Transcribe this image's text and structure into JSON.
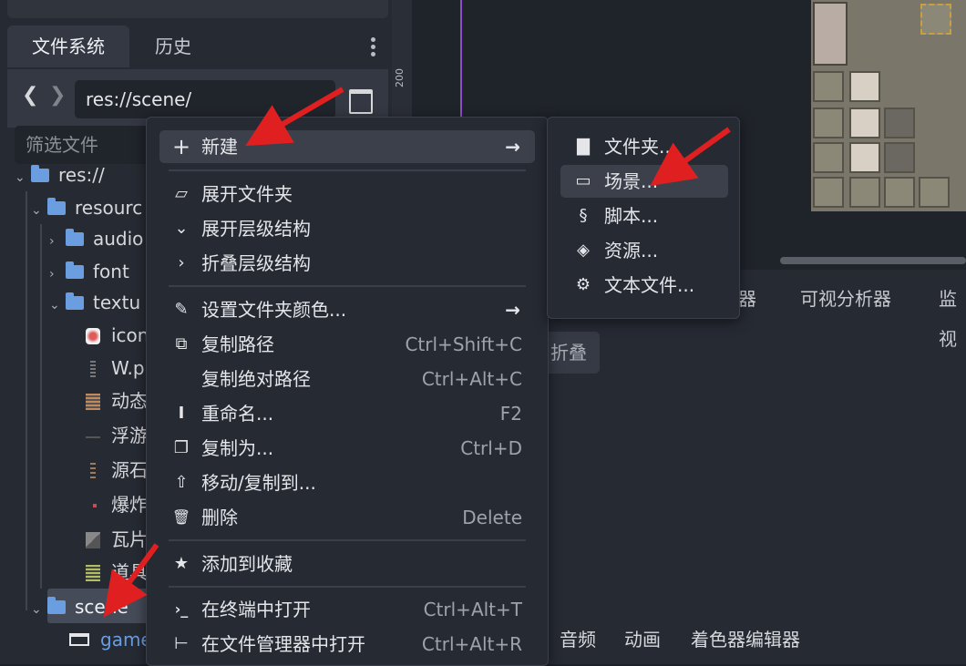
{
  "filesystem": {
    "tabs": [
      "文件系统",
      "历史"
    ],
    "path": "res://scene/",
    "filter_placeholder": "筛选文件",
    "ruler_label": "200",
    "tree": [
      {
        "label": "res://",
        "type": "folder"
      },
      {
        "label": "resourc",
        "type": "folder"
      },
      {
        "label": "audio",
        "type": "folder"
      },
      {
        "label": "font",
        "type": "folder"
      },
      {
        "label": "textu",
        "type": "folder"
      },
      {
        "label": "icon",
        "type": "file"
      },
      {
        "label": "W.p",
        "type": "file"
      },
      {
        "label": "动态",
        "type": "file"
      },
      {
        "label": "浮游",
        "type": "file"
      },
      {
        "label": "源石",
        "type": "file"
      },
      {
        "label": "爆炸",
        "type": "file"
      },
      {
        "label": "瓦片",
        "type": "file"
      },
      {
        "label": "道具",
        "type": "file"
      },
      {
        "label": "scene",
        "type": "folder"
      },
      {
        "label": "game",
        "type": "scene"
      }
    ]
  },
  "context_menu": {
    "items": [
      {
        "icon": "plus-icon",
        "glyph": "+",
        "label": "新建",
        "shortcut": "",
        "submenu": true
      },
      {
        "icon": "folder-open-icon",
        "glyph": "▱",
        "label": "展开文件夹",
        "shortcut": "",
        "submenu": false
      },
      {
        "icon": "chevron-down-icon",
        "glyph": "⌄",
        "label": "展开层级结构",
        "shortcut": "",
        "submenu": false
      },
      {
        "icon": "chevron-right-icon",
        "glyph": "›",
        "label": "折叠层级结构",
        "shortcut": "",
        "submenu": false
      },
      {
        "icon": "brush-icon",
        "glyph": "✎",
        "label": "设置文件夹颜色...",
        "shortcut": "",
        "submenu": true
      },
      {
        "icon": "copy-icon",
        "glyph": "⧉",
        "label": "复制路径",
        "shortcut": "Ctrl+Shift+C",
        "submenu": false
      },
      {
        "icon": "",
        "glyph": "",
        "label": "复制绝对路径",
        "shortcut": "Ctrl+Alt+C",
        "submenu": false
      },
      {
        "icon": "rename-icon",
        "glyph": "I",
        "label": "重命名...",
        "shortcut": "F2",
        "submenu": false
      },
      {
        "icon": "duplicate-icon",
        "glyph": "❐",
        "label": "复制为...",
        "shortcut": "Ctrl+D",
        "submenu": false
      },
      {
        "icon": "move-icon",
        "glyph": "⇧",
        "label": "移动/复制到...",
        "shortcut": "",
        "submenu": false
      },
      {
        "icon": "trash-icon",
        "glyph": "🗑",
        "label": "删除",
        "shortcut": "Delete",
        "submenu": false
      },
      {
        "icon": "star-icon",
        "glyph": "★",
        "label": "添加到收藏",
        "shortcut": "",
        "submenu": false
      },
      {
        "icon": "terminal-icon",
        "glyph": "›_",
        "label": "在终端中打开",
        "shortcut": "Ctrl+Alt+T",
        "submenu": false
      },
      {
        "icon": "file-manager-icon",
        "glyph": "⊢",
        "label": "在文件管理器中打开",
        "shortcut": "Ctrl+Alt+R",
        "submenu": false
      }
    ]
  },
  "submenu": {
    "items": [
      {
        "icon": "folder-icon",
        "glyph": "▇",
        "label": "文件夹..."
      },
      {
        "icon": "clapper-icon",
        "glyph": "▭",
        "label": "场景..."
      },
      {
        "icon": "script-icon",
        "glyph": "§",
        "label": "脚本..."
      },
      {
        "icon": "cube-icon",
        "glyph": "◈",
        "label": "资源..."
      },
      {
        "icon": "text-file-icon",
        "glyph": "⚙",
        "label": "文本文件..."
      }
    ]
  },
  "bottom_panel": {
    "top_tabs": [
      "器",
      "可视分析器",
      "监视"
    ],
    "collapse_label": "折叠",
    "tabs": [
      "音频",
      "动画",
      "着色器编辑器"
    ]
  }
}
